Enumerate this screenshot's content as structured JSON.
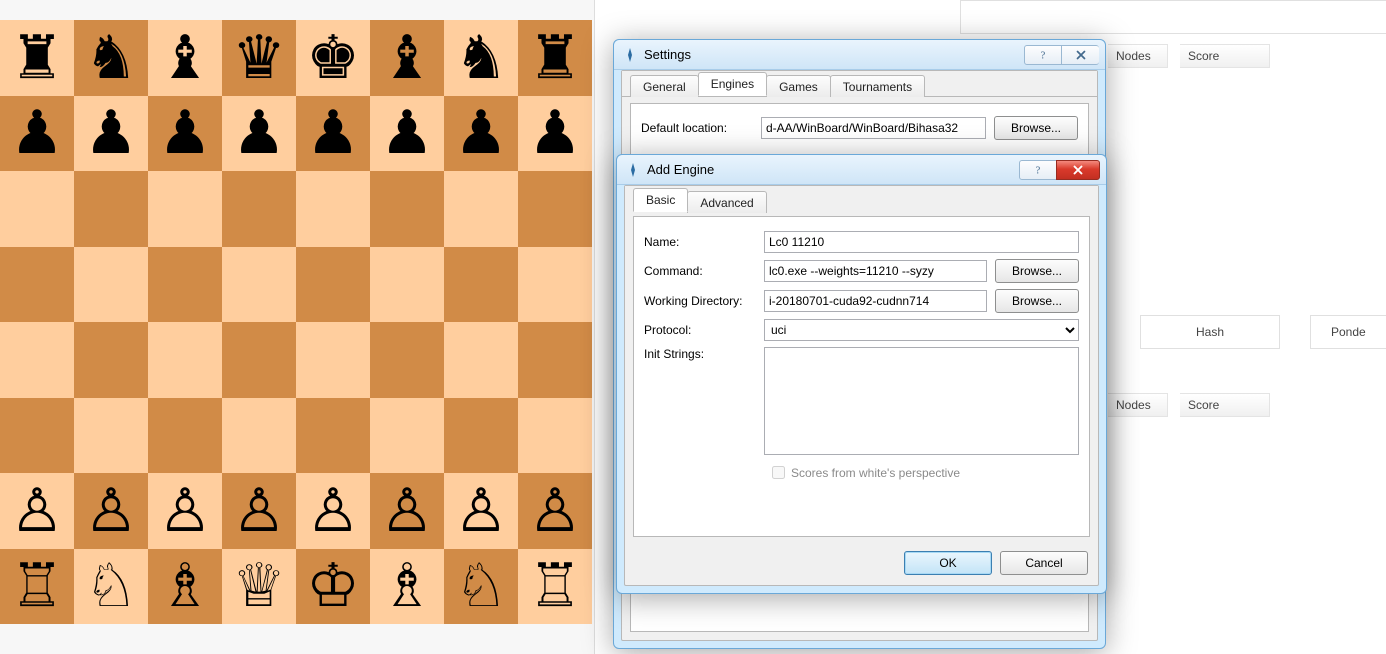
{
  "background": {
    "nodes_label": "Nodes",
    "score_label": "Score",
    "hash_label": "Hash",
    "ponde_label": "Ponde"
  },
  "board": {
    "position_fen_pieces": "rnbqkbnr/pppppppp/8/8/8/8/PPPPPPPP/RNBQKBNR"
  },
  "settings_window": {
    "title": "Settings",
    "tabs": [
      "General",
      "Engines",
      "Games",
      "Tournaments"
    ],
    "active_tab": 1,
    "default_location_label": "Default location:",
    "default_location_value": "d-AA/WinBoard/WinBoard/Bihasa32",
    "browse_label": "Browse..."
  },
  "add_engine_window": {
    "title": "Add Engine",
    "tabs": [
      "Basic",
      "Advanced"
    ],
    "active_tab": 0,
    "fields": {
      "name_label": "Name:",
      "name_value": "Lc0 11210",
      "command_label": "Command:",
      "command_value": "lc0.exe --weights=11210 --syzy",
      "workdir_label": "Working Directory:",
      "workdir_value": "i-20180701-cuda92-cudnn714",
      "protocol_label": "Protocol:",
      "protocol_value": "uci",
      "init_label": "Init Strings:",
      "init_value": "",
      "checkbox_label": "Scores from white's perspective",
      "checkbox_checked": false
    },
    "browse_label": "Browse...",
    "ok_label": "OK",
    "cancel_label": "Cancel"
  },
  "icons": {
    "app": "app-icon",
    "help": "help-icon",
    "close": "close-icon"
  }
}
